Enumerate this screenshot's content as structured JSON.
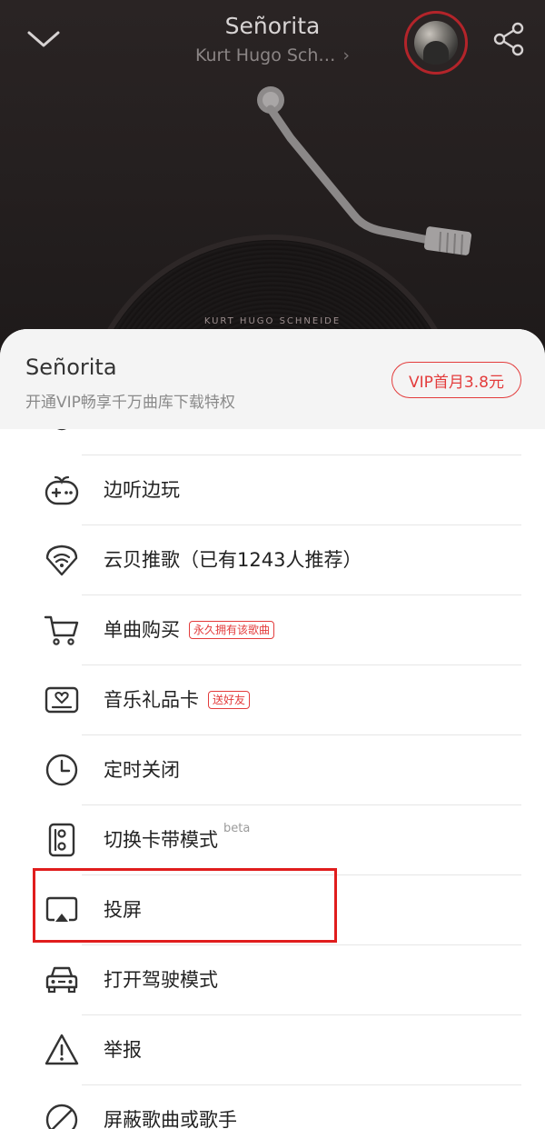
{
  "player": {
    "title": "Señorita",
    "artist": "Kurt Hugo Sch…",
    "artist_chevron": "›",
    "disc_text": "KURT HUGO SCHNEIDE"
  },
  "sheet": {
    "title": "Señorita",
    "subtitle": "开通VIP畅享千万曲库下载特权",
    "vip_button": "VIP首月3.8元"
  },
  "menu": {
    "items": [
      {
        "label": "",
        "icon": "partial-icon"
      },
      {
        "label": "边听边玩",
        "icon": "gamepad-icon"
      },
      {
        "label": "云贝推歌（已有1243人推荐）",
        "icon": "cloud-bean-icon"
      },
      {
        "label": "单曲购买",
        "badge": "永久拥有该歌曲",
        "icon": "cart-icon"
      },
      {
        "label": "音乐礼品卡",
        "badge": "送好友",
        "icon": "gift-card-icon"
      },
      {
        "label": "定时关闭",
        "icon": "clock-icon"
      },
      {
        "label": "切换卡带模式",
        "sup": "beta",
        "icon": "cassette-icon"
      },
      {
        "label": "投屏",
        "icon": "cast-screen-icon"
      },
      {
        "label": "打开驾驶模式",
        "icon": "car-icon"
      },
      {
        "label": "举报",
        "icon": "warning-icon"
      },
      {
        "label": "屏蔽歌曲或歌手",
        "icon": "block-icon"
      }
    ]
  },
  "colors": {
    "accent": "#e33c3c",
    "highlight": "#e01d1d",
    "player_bg": "#241f1f"
  }
}
